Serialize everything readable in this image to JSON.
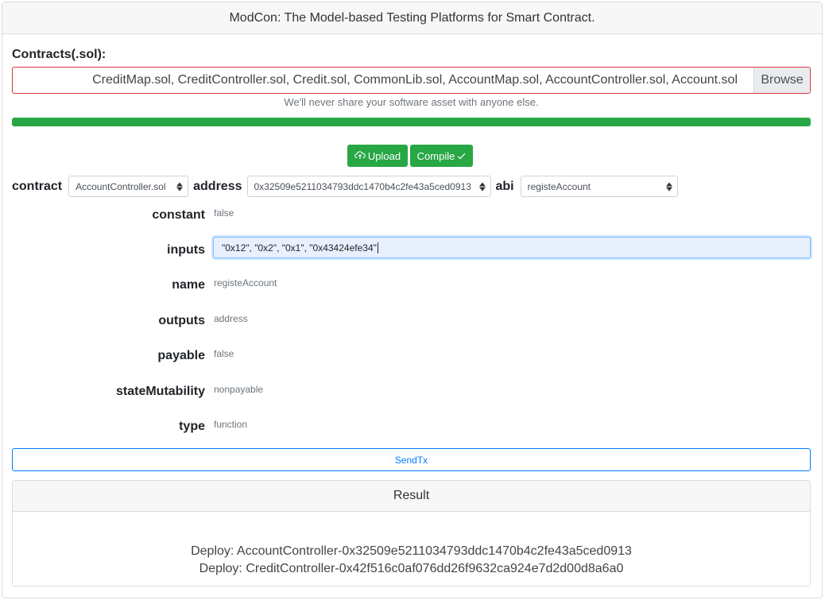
{
  "header": {
    "title": "ModCon: The Model-based Testing Platforms for Smart Contract."
  },
  "contracts": {
    "label": "Contracts(.sol):",
    "files": "CreditMap.sol, CreditController.sol, Credit.sol, CommonLib.sol, AccountMap.sol, AccountController.sol, Account.sol",
    "browse_label": "Browse",
    "help_text": "We'll never share your software asset with anyone else."
  },
  "progress": {
    "value_percent": 100,
    "color": "#28a745"
  },
  "actions": {
    "upload_label": "Upload",
    "compile_label": "Compile"
  },
  "selectors": {
    "contract_label": "contract",
    "contract_value": "AccountController.sol",
    "address_label": "address",
    "address_value": "0x32509e5211034793ddc1470b4c2fe43a5ced0913",
    "abi_label": "abi",
    "abi_value": "registeAccount"
  },
  "fields": {
    "constant": {
      "label": "constant",
      "value": "false"
    },
    "inputs": {
      "label": "inputs",
      "value": "\"0x12\", \"0x2\", \"0x1\", \"0x43424efe34\""
    },
    "name": {
      "label": "name",
      "value": "registeAccount"
    },
    "outputs": {
      "label": "outputs",
      "value": "address"
    },
    "payable": {
      "label": "payable",
      "value": "false"
    },
    "stateMutability": {
      "label": "stateMutability",
      "value": "nonpayable"
    },
    "type": {
      "label": "type",
      "value": "function"
    }
  },
  "sendtx": {
    "label": "SendTx"
  },
  "result": {
    "title": "Result",
    "lines": [
      "Deploy: AccountController-0x32509e5211034793ddc1470b4c2fe43a5ced0913",
      "Deploy: CreditController-0x42f516c0af076dd26f9632ca924e7d2d00d8a6a0"
    ]
  },
  "colors": {
    "accent_green": "#28a745",
    "accent_blue": "#007bff",
    "error_border": "#dc3545"
  }
}
